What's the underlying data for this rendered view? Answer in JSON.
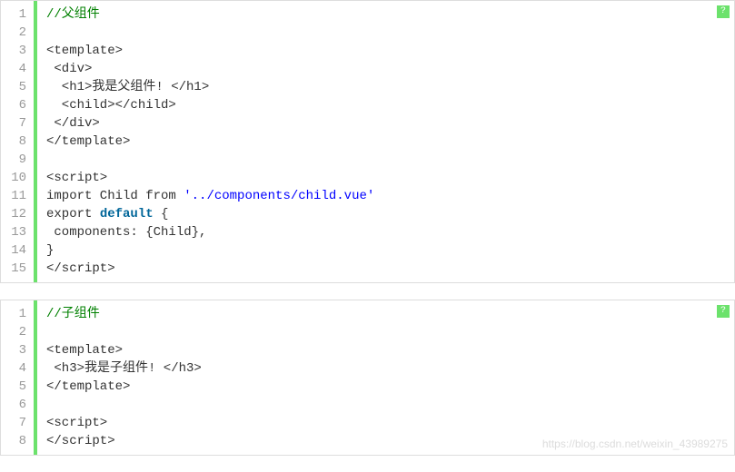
{
  "blocks": [
    {
      "lines": 15,
      "code": [
        [
          {
            "t": "//父组件",
            "c": "cn"
          }
        ],
        [
          {
            "t": "",
            "c": ""
          }
        ],
        [
          {
            "t": "<template>",
            "c": ""
          }
        ],
        [
          {
            "t": " <div>",
            "c": ""
          }
        ],
        [
          {
            "t": "  <h1>我是父组件! </h1>",
            "c": ""
          }
        ],
        [
          {
            "t": "  <child></child>",
            "c": ""
          }
        ],
        [
          {
            "t": " </div>",
            "c": ""
          }
        ],
        [
          {
            "t": "</template>",
            "c": ""
          }
        ],
        [
          {
            "t": "",
            "c": ""
          }
        ],
        [
          {
            "t": "<script>",
            "c": ""
          }
        ],
        [
          {
            "t": "import Child from ",
            "c": ""
          },
          {
            "t": "'../components/child.vue'",
            "c": "str"
          }
        ],
        [
          {
            "t": "export ",
            "c": ""
          },
          {
            "t": "default",
            "c": "kw"
          },
          {
            "t": " {",
            "c": ""
          }
        ],
        [
          {
            "t": " components: {Child},",
            "c": ""
          }
        ],
        [
          {
            "t": "}",
            "c": ""
          }
        ],
        [
          {
            "t": "</script>",
            "c": ""
          }
        ]
      ]
    },
    {
      "lines": 8,
      "code": [
        [
          {
            "t": "//子组件",
            "c": "cn"
          }
        ],
        [
          {
            "t": "",
            "c": ""
          }
        ],
        [
          {
            "t": "<template>",
            "c": ""
          }
        ],
        [
          {
            "t": " <h3>我是子组件! </h3>",
            "c": ""
          }
        ],
        [
          {
            "t": "</template>",
            "c": ""
          }
        ],
        [
          {
            "t": "",
            "c": ""
          }
        ],
        [
          {
            "t": "<script>",
            "c": ""
          }
        ],
        [
          {
            "t": "</script>",
            "c": ""
          }
        ]
      ]
    }
  ],
  "badge_glyph": "?",
  "watermark": "https://blog.csdn.net/weixin_43989275"
}
